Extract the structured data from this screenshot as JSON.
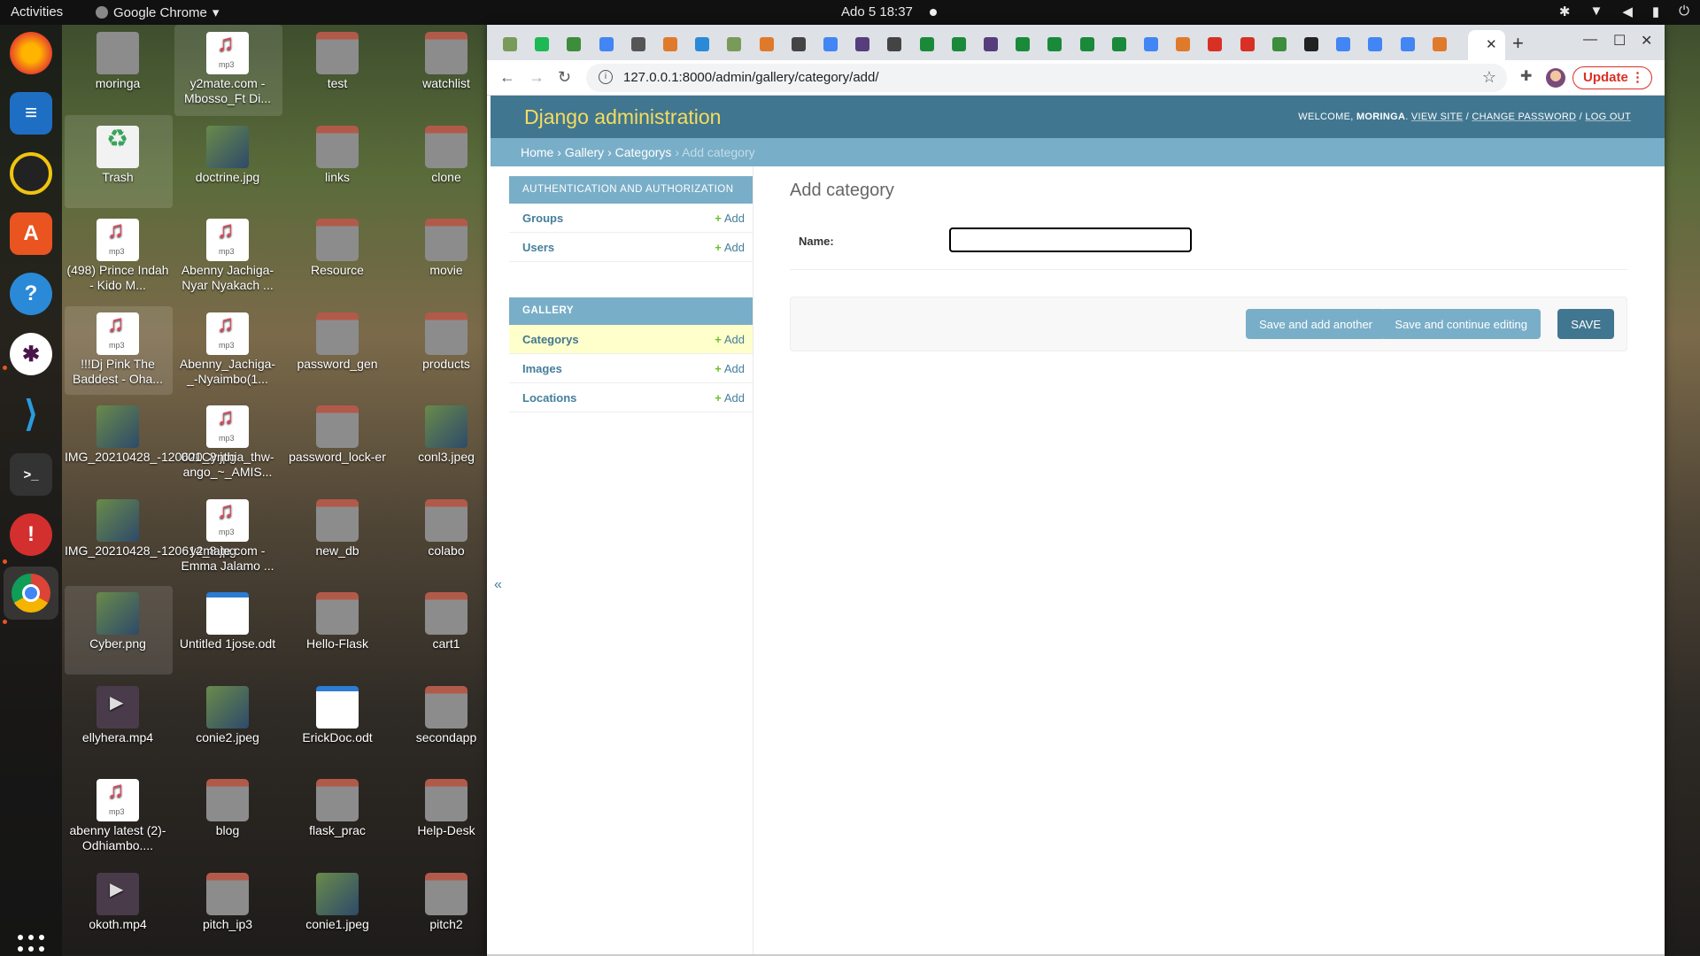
{
  "topbar": {
    "activities": "Activities",
    "app_name": "Google Chrome",
    "clock": "Ado 5  18:37"
  },
  "desktop": {
    "icons": [
      {
        "label": "moringa",
        "type": "home"
      },
      {
        "label": "y2mate.com - Mbosso_Ft Di...",
        "type": "mp3"
      },
      {
        "label": "test",
        "type": "folder"
      },
      {
        "label": "watchlist",
        "type": "folder"
      },
      {
        "label": "Trash",
        "type": "trash"
      },
      {
        "label": "doctrine.jpg",
        "type": "img"
      },
      {
        "label": "links",
        "type": "folder"
      },
      {
        "label": "clone",
        "type": "folder"
      },
      {
        "label": "(498) Prince Indah - Kido M...",
        "type": "mp3"
      },
      {
        "label": "Abenny Jachiga-Nyar Nyakach ...",
        "type": "mp3"
      },
      {
        "label": "Resource",
        "type": "folder"
      },
      {
        "label": "movie",
        "type": "folder"
      },
      {
        "label": "!!!Dj Pink The Baddest - Oha...",
        "type": "mp3"
      },
      {
        "label": "Abenny_Jachiga-_-Nyaimbo(1...",
        "type": "mp3"
      },
      {
        "label": "password_gen",
        "type": "folder"
      },
      {
        "label": "products",
        "type": "folder"
      },
      {
        "label": "IMG_20210428_-120620_8.jpg",
        "type": "img"
      },
      {
        "label": "001Cynthia_thw-ango_~_AMIS...",
        "type": "mp3"
      },
      {
        "label": "password_lock-er",
        "type": "folder"
      },
      {
        "label": "conl3.jpeg",
        "type": "img"
      },
      {
        "label": "IMG_20210428_-120614_8.jpg",
        "type": "img"
      },
      {
        "label": "y2mate.com - Emma Jalamo ...",
        "type": "mp3"
      },
      {
        "label": "new_db",
        "type": "folder"
      },
      {
        "label": "colabo",
        "type": "folder"
      },
      {
        "label": "Cyber.png",
        "type": "img"
      },
      {
        "label": "Untitled 1jose.odt",
        "type": "doc"
      },
      {
        "label": "Hello-Flask",
        "type": "folder"
      },
      {
        "label": "cart1",
        "type": "folder"
      },
      {
        "label": "ellyhera.mp4",
        "type": "video"
      },
      {
        "label": "conie2.jpeg",
        "type": "img"
      },
      {
        "label": "ErickDoc.odt",
        "type": "doc"
      },
      {
        "label": "secondapp",
        "type": "folder"
      },
      {
        "label": "abenny latest (2)-Odhiambo....",
        "type": "mp3"
      },
      {
        "label": "blog",
        "type": "folder"
      },
      {
        "label": "flask_prac",
        "type": "folder"
      },
      {
        "label": "Help-Desk",
        "type": "folder"
      },
      {
        "label": "okoth.mp4",
        "type": "video"
      },
      {
        "label": "pitch_ip3",
        "type": "folder"
      },
      {
        "label": "conie1.jpeg",
        "type": "img"
      },
      {
        "label": "pitch2",
        "type": "folder"
      }
    ]
  },
  "browser": {
    "url": "127.0.0.1:8000/admin/gallery/category/add/",
    "update_label": "Update"
  },
  "django": {
    "brand": "Django administration",
    "welcome": "WELCOME,",
    "username": "MORINGA",
    "view_site": "VIEW SITE",
    "change_password": "CHANGE PASSWORD",
    "log_out": "LOG OUT",
    "sep": "/",
    "breadcrumbs": {
      "home": "Home",
      "gallery": "Gallery",
      "categorys": "Categorys",
      "current": "Add category",
      "sep": "›"
    },
    "modules": [
      {
        "caption": "Authentication and Authorization",
        "rows": [
          {
            "label": "Groups",
            "add": "Add"
          },
          {
            "label": "Users",
            "add": "Add"
          }
        ]
      },
      {
        "caption": "Gallery",
        "rows": [
          {
            "label": "Categorys",
            "add": "Add"
          },
          {
            "label": "Images",
            "add": "Add"
          },
          {
            "label": "Locations",
            "add": "Add"
          }
        ]
      }
    ],
    "collapse": "«",
    "form": {
      "title": "Add category",
      "name_label": "Name:",
      "name_value": "",
      "save_add_another": "Save and add another",
      "save_continue": "Save and continue editing",
      "save": "SAVE"
    }
  },
  "colors": {
    "header": "#417690",
    "breadcrumbs": "#79aec8",
    "brand": "#f5dd5d",
    "current_row": "#ffffcc"
  }
}
